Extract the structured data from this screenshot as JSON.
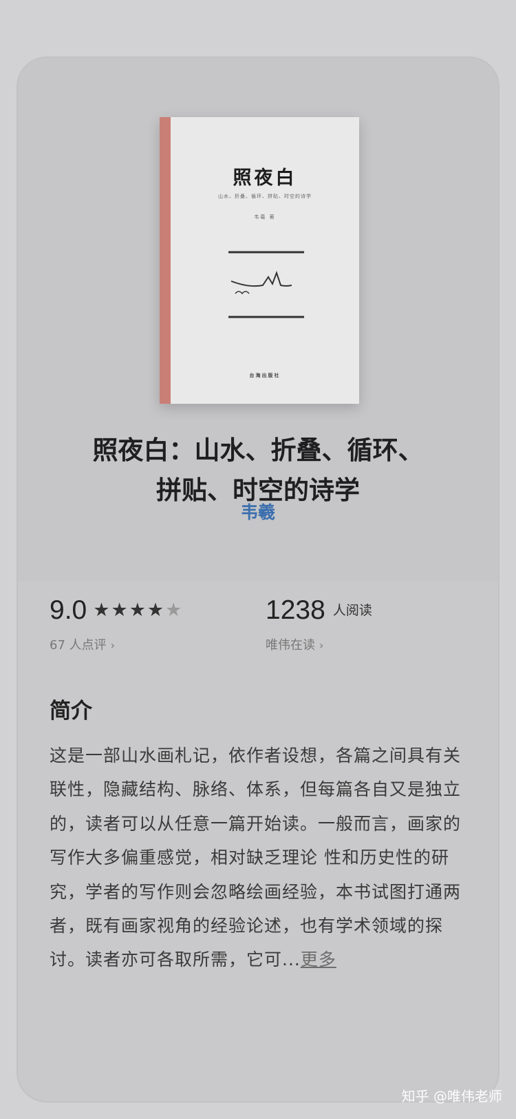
{
  "book": {
    "cover_title": "照夜白",
    "cover_subtitle": "山水、折叠、循环、拼贴、时空的诗学",
    "cover_author": "韦羲 著",
    "cover_publisher": "台海出版社",
    "title_line1": "照夜白：山水、折叠、循环、",
    "title_line2": "拼贴、时空的诗学",
    "author": "韦羲"
  },
  "stats": {
    "rating": "9.0",
    "stars_full": "★★★★",
    "stars_half": "★",
    "rating_count": "67 人点评",
    "readers": "1238",
    "readers_unit": "人阅读",
    "reading_now": "唯伟在读",
    "chevron": "›"
  },
  "intro": {
    "heading": "简介",
    "text": "这是一部山水画札记，依作者设想，各篇之间具有关联性，隐藏结构、脉络、体系，但每篇各自又是独立的，读者可以从任意一篇开始读。一般而言，画家的写作大多偏重感觉，相对缺乏理论 性和历史性的研究，学者的写作则会忽略绘画经验，本书试图打通两者，既有画家视角的经验论述，也有学术领域的探讨。读者亦可各取所需，它可...",
    "more": "更多"
  },
  "watermark": "知乎 @唯伟老师",
  "colors": {
    "background": "#d2d2d4",
    "spine": "#c97f75",
    "author_link": "#3b6fae"
  }
}
